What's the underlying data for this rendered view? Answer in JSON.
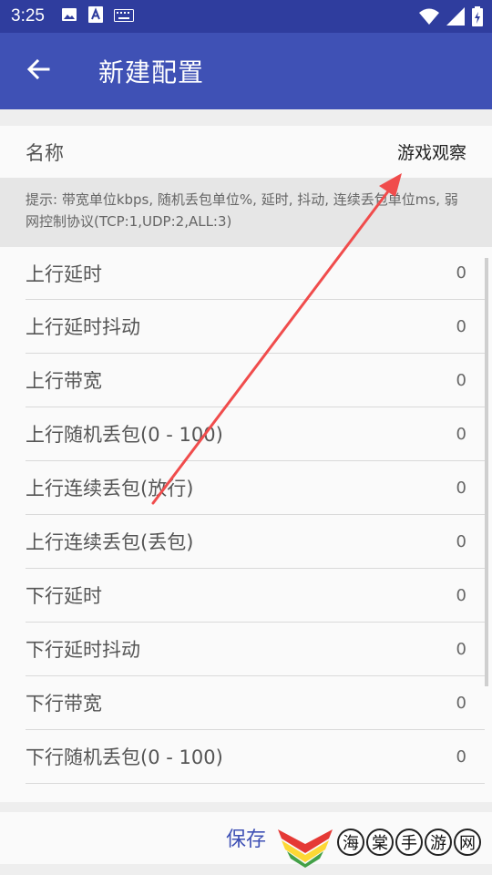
{
  "status_bar": {
    "time": "3:25",
    "left_icons": [
      "image-icon",
      "font-icon",
      "keyboard-icon"
    ],
    "right_icons": [
      "wifi-icon",
      "signal-icon",
      "battery-icon"
    ]
  },
  "app_bar": {
    "back_icon": "arrow-left-icon",
    "title": "新建配置",
    "color": "#3f51b5"
  },
  "name_field": {
    "label": "名称",
    "value": "游戏观察"
  },
  "hint": "提示: 带宽单位kbps, 随机丢包单位%, 延时, 抖动, 连续丢包单位ms, 弱网控制协议(TCP:1,UDP:2,ALL:3)",
  "settings": [
    {
      "label": "上行延时",
      "value": "0"
    },
    {
      "label": "上行延时抖动",
      "value": "0"
    },
    {
      "label": "上行带宽",
      "value": "0"
    },
    {
      "label": "上行随机丢包(0 - 100)",
      "value": "0"
    },
    {
      "label": "上行连续丢包(放行)",
      "value": "0"
    },
    {
      "label": "上行连续丢包(丢包)",
      "value": "0"
    },
    {
      "label": "下行延时",
      "value": "0"
    },
    {
      "label": "下行延时抖动",
      "value": "0"
    },
    {
      "label": "下行带宽",
      "value": "0"
    },
    {
      "label": "下行随机丢包(0 - 100)",
      "value": "0"
    }
  ],
  "bottom_bar": {
    "save_label": "保存"
  },
  "watermark": {
    "chars": [
      "海",
      "棠",
      "手",
      "游",
      "网"
    ]
  },
  "annotation": {
    "color": "#f04c4c"
  }
}
